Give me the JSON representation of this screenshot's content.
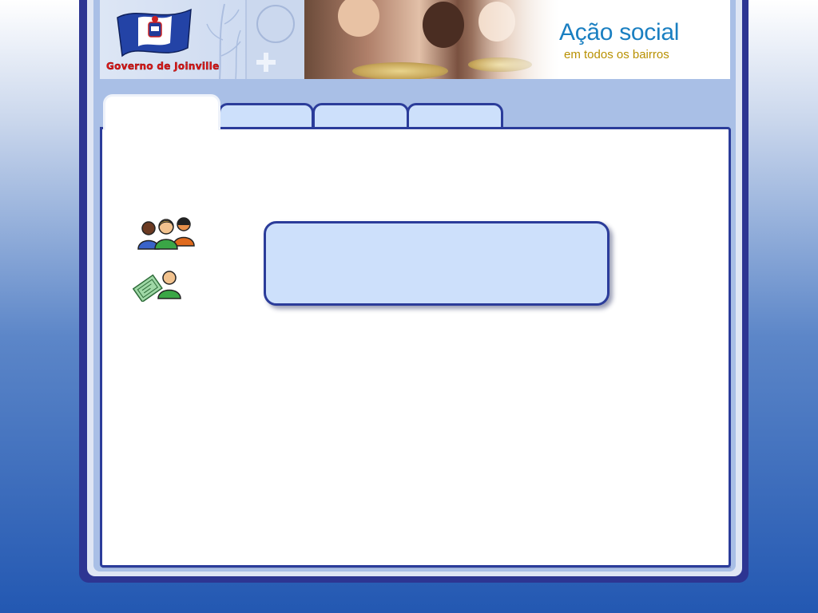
{
  "header": {
    "government_label": "Governo de Joinville",
    "slogan_title": "Ação social",
    "slogan_subtitle": "em todos os bairros"
  },
  "tabs": [
    {
      "label": "",
      "active": true
    },
    {
      "label": "",
      "active": false
    },
    {
      "label": "",
      "active": false
    },
    {
      "label": "",
      "active": false
    }
  ],
  "content": {
    "icon_people_group": "people-group-icon",
    "icon_person_document": "person-document-icon",
    "info_box_text": ""
  },
  "colors": {
    "frame_dark_blue": "#2d3592",
    "tab_fill": "#cde0fb",
    "slogan_blue": "#1a7fc1",
    "slogan_gold": "#b89000",
    "government_red": "#e11a1a"
  }
}
